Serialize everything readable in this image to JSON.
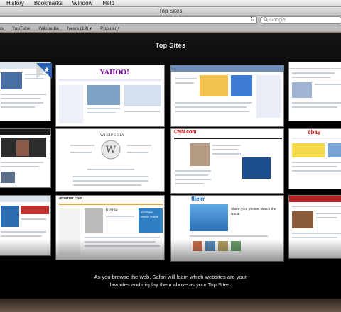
{
  "menubar": {
    "items": [
      "History",
      "Bookmarks",
      "Window",
      "Help"
    ]
  },
  "window": {
    "title": "Top Sites"
  },
  "toolbar": {
    "search_placeholder": "Google",
    "reload_glyph": "↻"
  },
  "bookmarks": {
    "items": [
      "ps",
      "YouTube",
      "Wikipedia",
      "News (19) ▾",
      "Popular ▾"
    ]
  },
  "topsites": {
    "heading": "Top Sites",
    "thumbnail_labels": {
      "yahoo": "YAHOO!",
      "wikipedia": "WIKIPEDIA",
      "cnn": "CNN.com",
      "flickr": "flickr",
      "ebay": "ebay",
      "amazon": "amazon.com",
      "kindle": "Kindle",
      "summer": "Summer Movie Guide",
      "flickr_caption": "Share your photos. Watch the world."
    },
    "message_line1": "As you browse the web, Safari will learn which websites are your",
    "message_line2": "favorites and display them above as your Top Sites."
  },
  "colors": {
    "background": "#000000",
    "chrome": "#c6c6c6",
    "accent_blue": "#2a62b8",
    "cnn_red": "#cc0000"
  }
}
